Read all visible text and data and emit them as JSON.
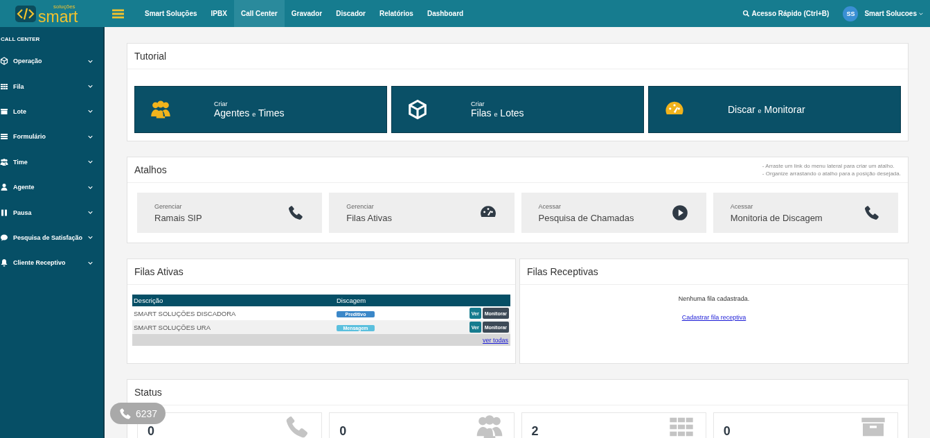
{
  "logo": {
    "small": "soluções",
    "main": "smart"
  },
  "nav": [
    {
      "label": "Smart Soluções",
      "selected": false
    },
    {
      "label": "IPBX",
      "selected": false
    },
    {
      "label": "Call Center",
      "selected": true
    },
    {
      "label": "Gravador",
      "selected": false
    },
    {
      "label": "Discador",
      "selected": false
    },
    {
      "label": "Relatórios",
      "selected": false
    },
    {
      "label": "Dashboard",
      "selected": false
    }
  ],
  "quick_access": "Acesso Rápido (Ctrl+B)",
  "user": {
    "initials": "SS",
    "name": "Smart Solucoes"
  },
  "sidebar": {
    "heading": "CALL CENTER",
    "items": [
      {
        "label": "Operação",
        "expanded": false
      },
      {
        "label": "Fila",
        "expanded": false
      },
      {
        "label": "Lote",
        "expanded": false
      },
      {
        "label": "Formulário",
        "expanded": false
      },
      {
        "label": "Time",
        "expanded": false
      },
      {
        "label": "Agente",
        "expanded": false
      },
      {
        "label": "Pausa",
        "expanded": false
      },
      {
        "label": "Pesquisa de Satisfação",
        "expanded": false
      },
      {
        "label": "Cliente Receptivo",
        "expanded": false
      }
    ]
  },
  "tutorial": {
    "title": "Tutorial",
    "tiles": [
      {
        "pre": "Criar",
        "first": "Agentes",
        "joiner": "e",
        "second": "Times"
      },
      {
        "pre": "Criar",
        "first": "Filas",
        "joiner": "e",
        "second": "Lotes"
      },
      {
        "first": "Discar",
        "joiner": "e",
        "second": "Monitorar"
      }
    ]
  },
  "shortcuts": {
    "title": "Atalhos",
    "hints": [
      "- Arraste um link do menu lateral para criar um atalho.",
      "- Organize arrastando o atalho para a posição desejada."
    ],
    "items": [
      {
        "action": "Gerenciar",
        "label": "Ramais SIP"
      },
      {
        "action": "Gerenciar",
        "label": "Filas Ativas"
      },
      {
        "action": "Acessar",
        "label": "Pesquisa de Chamadas"
      },
      {
        "action": "Acessar",
        "label": "Monitoria de Discagem"
      }
    ]
  },
  "active_queues": {
    "title": "Filas Ativas",
    "columns": [
      "Descrição",
      "Discagem"
    ],
    "rows": [
      {
        "name": "SMART SOLUÇÕES DISCADORA",
        "mode": "Preditivo",
        "color": "#3b87c8",
        "view": "Ver",
        "monitor": "Monitorar"
      },
      {
        "name": "SMART SOLUÇÕES URA",
        "mode": "Mensagem",
        "color": "#5bc0de",
        "view": "Ver",
        "monitor": "Monitorar"
      }
    ],
    "see_all": "ver todas"
  },
  "receptive_queues": {
    "title": "Filas Receptivas",
    "empty": "Nenhuma fila cadastrada.",
    "link": "Cadastrar fila receptiva"
  },
  "status": {
    "title": "Status",
    "tiles": [
      {
        "value": "0"
      },
      {
        "value": "0"
      },
      {
        "value": "2"
      },
      {
        "value": "0"
      }
    ]
  },
  "extension_badge": "6237"
}
